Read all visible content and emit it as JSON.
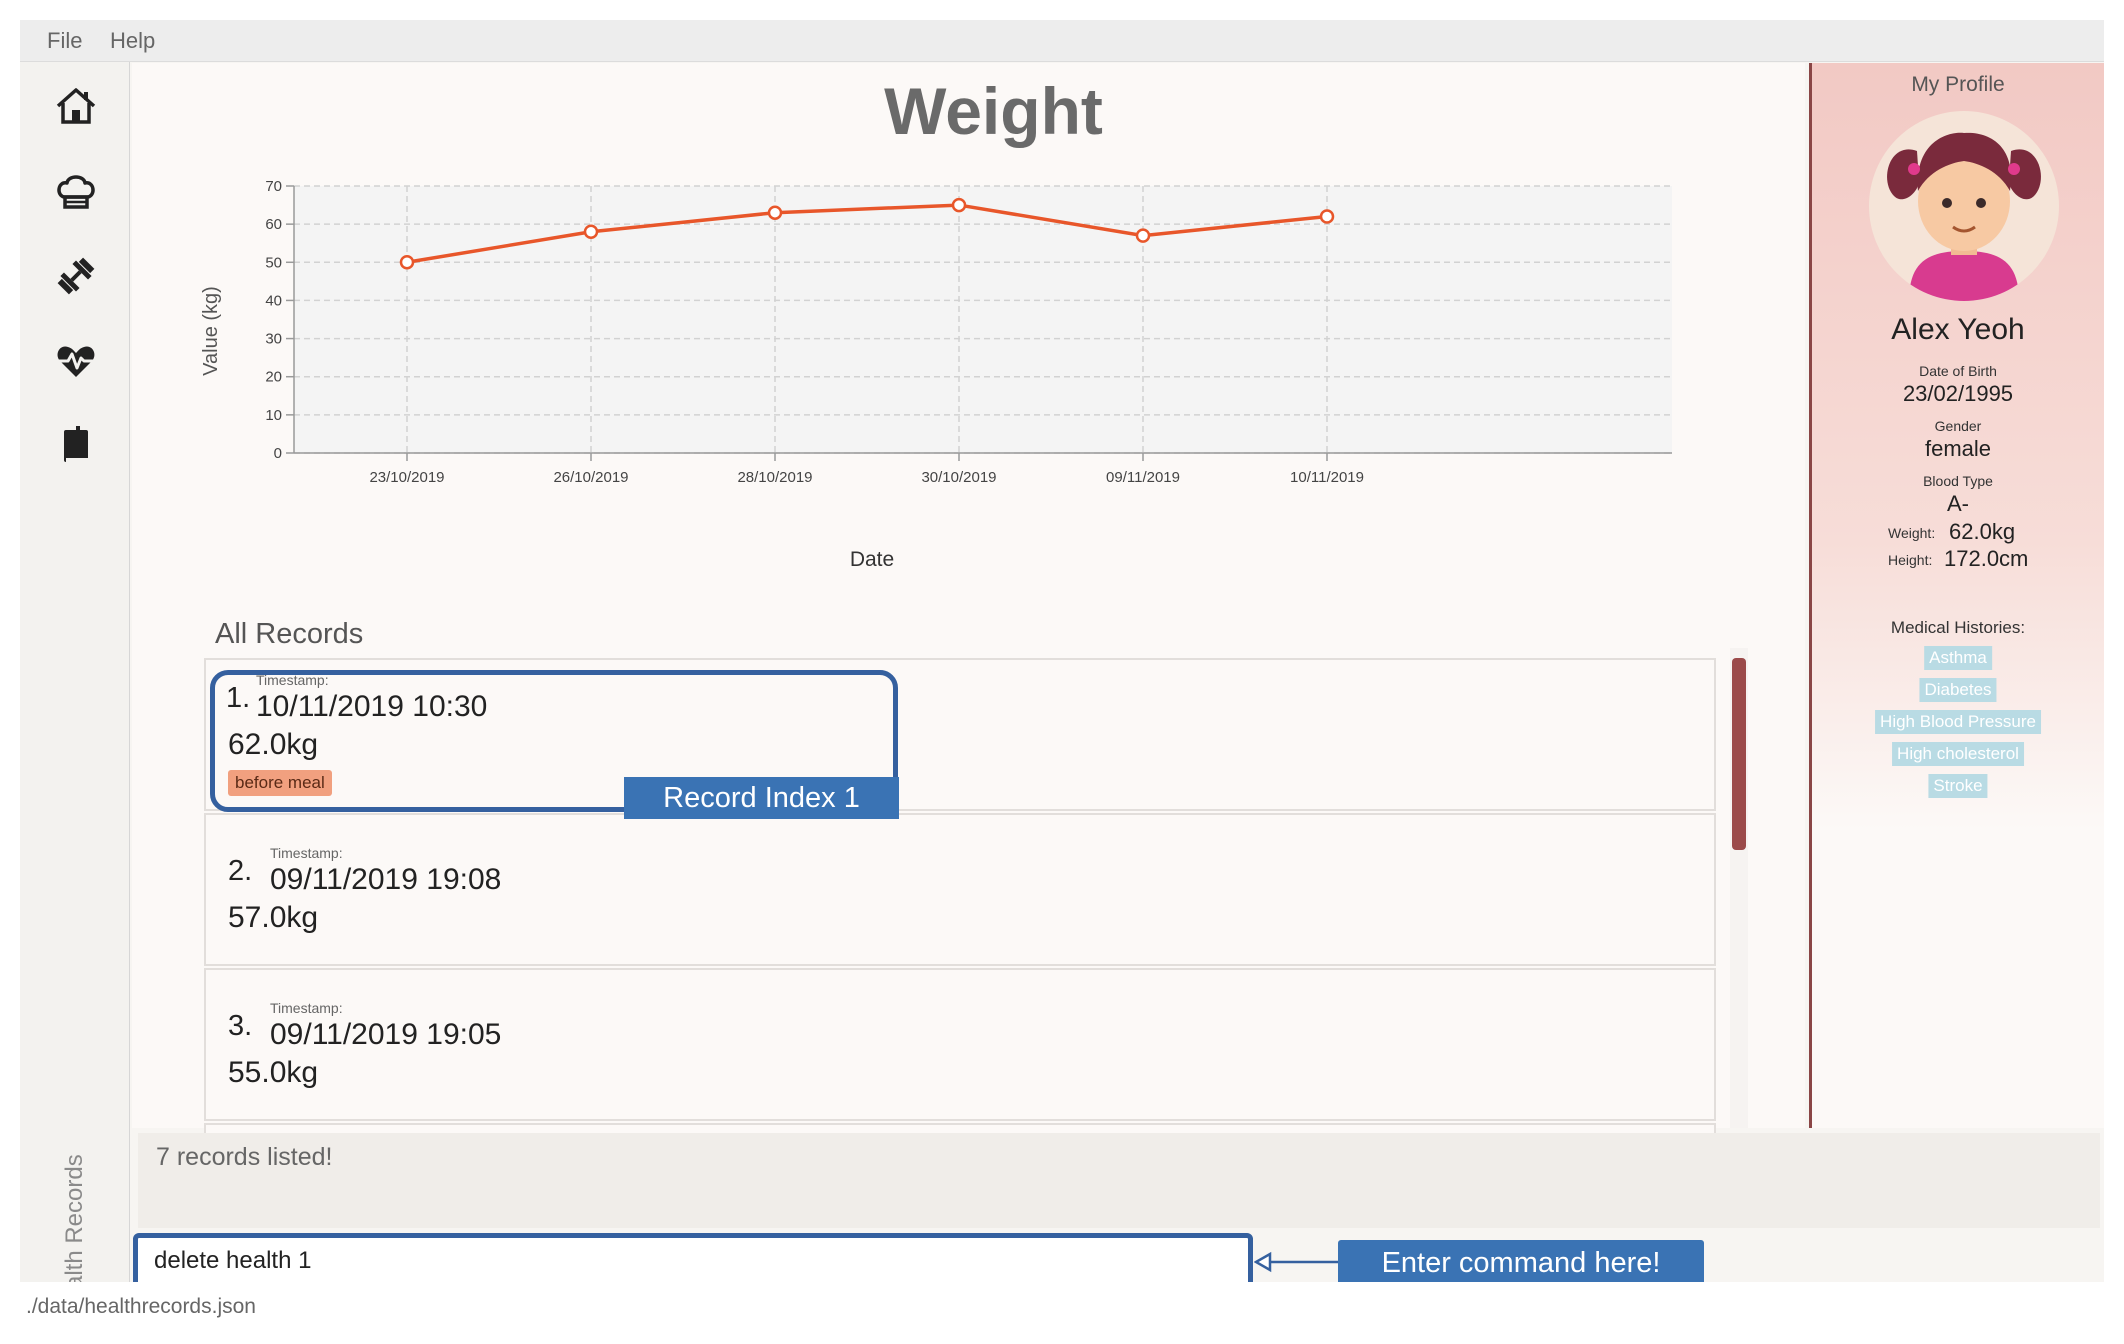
{
  "menu": {
    "file": "File",
    "help": "Help"
  },
  "sidebar": {
    "icons": [
      "home-icon",
      "chef-hat-icon",
      "dumbbell-icon",
      "heartbeat-icon",
      "book-icon"
    ],
    "vertical_label": "Health Records"
  },
  "main": {
    "title": "Weight",
    "records_title": "All Records"
  },
  "chart_data": {
    "type": "line",
    "title": "Weight",
    "xlabel": "Date",
    "ylabel": "Value (kg)",
    "categories": [
      "23/10/2019",
      "26/10/2019",
      "28/10/2019",
      "30/10/2019",
      "09/11/2019",
      "10/11/2019"
    ],
    "values": [
      50,
      58,
      63,
      65,
      57,
      62
    ],
    "ylim": [
      0,
      70
    ],
    "yticks": [
      0,
      10,
      20,
      30,
      40,
      50,
      60,
      70
    ],
    "grid": true,
    "color": "#e8562a"
  },
  "records": [
    {
      "index": "1.",
      "timestamp_label": "Timestamp:",
      "timestamp": "10/11/2019 10:30",
      "value": "62.0kg",
      "tag": "before meal"
    },
    {
      "index": "2.",
      "timestamp_label": "Timestamp:",
      "timestamp": "09/11/2019 19:08",
      "value": "57.0kg"
    },
    {
      "index": "3.",
      "timestamp_label": "Timestamp:",
      "timestamp": "09/11/2019 19:05",
      "value": "55.0kg"
    }
  ],
  "profile": {
    "header": "My Profile",
    "name": "Alex Yeoh",
    "dob_label": "Date of Birth",
    "dob": "23/02/1995",
    "gender_label": "Gender",
    "gender": "female",
    "blood_label": "Blood Type",
    "blood": "A-",
    "weight_label": "Weight:",
    "weight": "62.0kg",
    "height_label": "Height:",
    "height": "172.0cm",
    "histories_label": "Medical Histories:",
    "histories": [
      "Asthma",
      "Diabetes",
      "High Blood Pressure",
      "High cholesterol",
      "Stroke"
    ]
  },
  "result": {
    "text": "7 records listed!"
  },
  "command": {
    "value": "delete health 1"
  },
  "status": {
    "path": "./data/healthrecords.json"
  },
  "callouts": {
    "record": "Record Index 1",
    "command": "Enter command here!"
  },
  "colors": {
    "accent": "#35609f",
    "callout": "#3a73b4",
    "line": "#e8562a",
    "scroll": "#9b4a4a"
  }
}
